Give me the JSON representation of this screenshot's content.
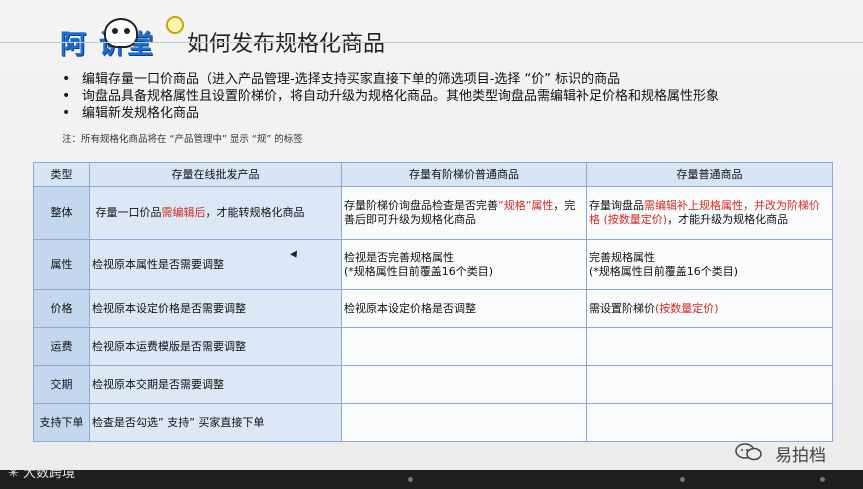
{
  "logo": {
    "text": "阿 讲堂"
  },
  "title": "如何发布规格化商品",
  "bullets": [
    "编辑存量一口价商品（进入产品管理-选择支持买家直接下单的筛选项目-选择 “价” 标识的商品",
    "询盘品具备规格属性且设置阶梯价，将自动升级为规格化商品。其他类型询盘品需编辑补足价格和规格属性形象",
    "编辑新发规格化商品"
  ],
  "note": "注：所有规格化商品将在 “产品管理中” 显示 “规” 的标签",
  "table": {
    "headers": [
      "类型",
      "存量在线批发产品",
      "存量有阶梯价普通商品",
      "存量普通商品"
    ],
    "rows": [
      {
        "type": "整体",
        "c1_pre": "存量一口价品",
        "c1_red": "需编辑后",
        "c1_post": "，才能转规格化商品",
        "c2_pre": "存量阶梯价询盘品检查是否完善",
        "c2_red": "”规格”属性",
        "c2_post": "，完善后即可升级为规格化商品",
        "c3_pre": "存量询盘品",
        "c3_red": "需编辑补上规格属性，并改为阶梯价格 (按数量定价)",
        "c3_post": "，才能升级为规格化商品"
      },
      {
        "type": "属性",
        "c1": "检视原本属性是否需要调整",
        "c2_line1": "检视是否完善规格属性",
        "c2_line2": "(*规格属性目前覆盖16个类目)",
        "c3_line1": "完善规格属性",
        "c3_line2": "(*规格属性目前覆盖16个类目)"
      },
      {
        "type": "价格",
        "c1": "检视原本设定价格是否需要调整",
        "c2": "检视原本设定价格是否调整",
        "c3_pre": "需设置阶梯价",
        "c3_red": "(按数量定价)"
      },
      {
        "type": "运费",
        "c1": "检视原本运费模版是否需要调整"
      },
      {
        "type": "交期",
        "c1": "检视原本交期是否需要调整"
      },
      {
        "type": "支持下单",
        "c1": "检查是否勾选” 支持” 买家直接下单"
      }
    ]
  },
  "watermarks": {
    "left": "大数跨境",
    "right": "易拍档"
  },
  "colors": {
    "header_bg": "#d7e4f4",
    "type_col_bg": "#c5d7ef",
    "col1_bg": "#dde8f6",
    "border": "#8ea9d1",
    "highlight_red": "#d62b1f",
    "logo_blue": "#1d6fd1"
  },
  "icons": {
    "logo": "cow-mascot-logo",
    "watermark_right": "wechat-icon",
    "cursor": "mouse-pointer-icon"
  }
}
